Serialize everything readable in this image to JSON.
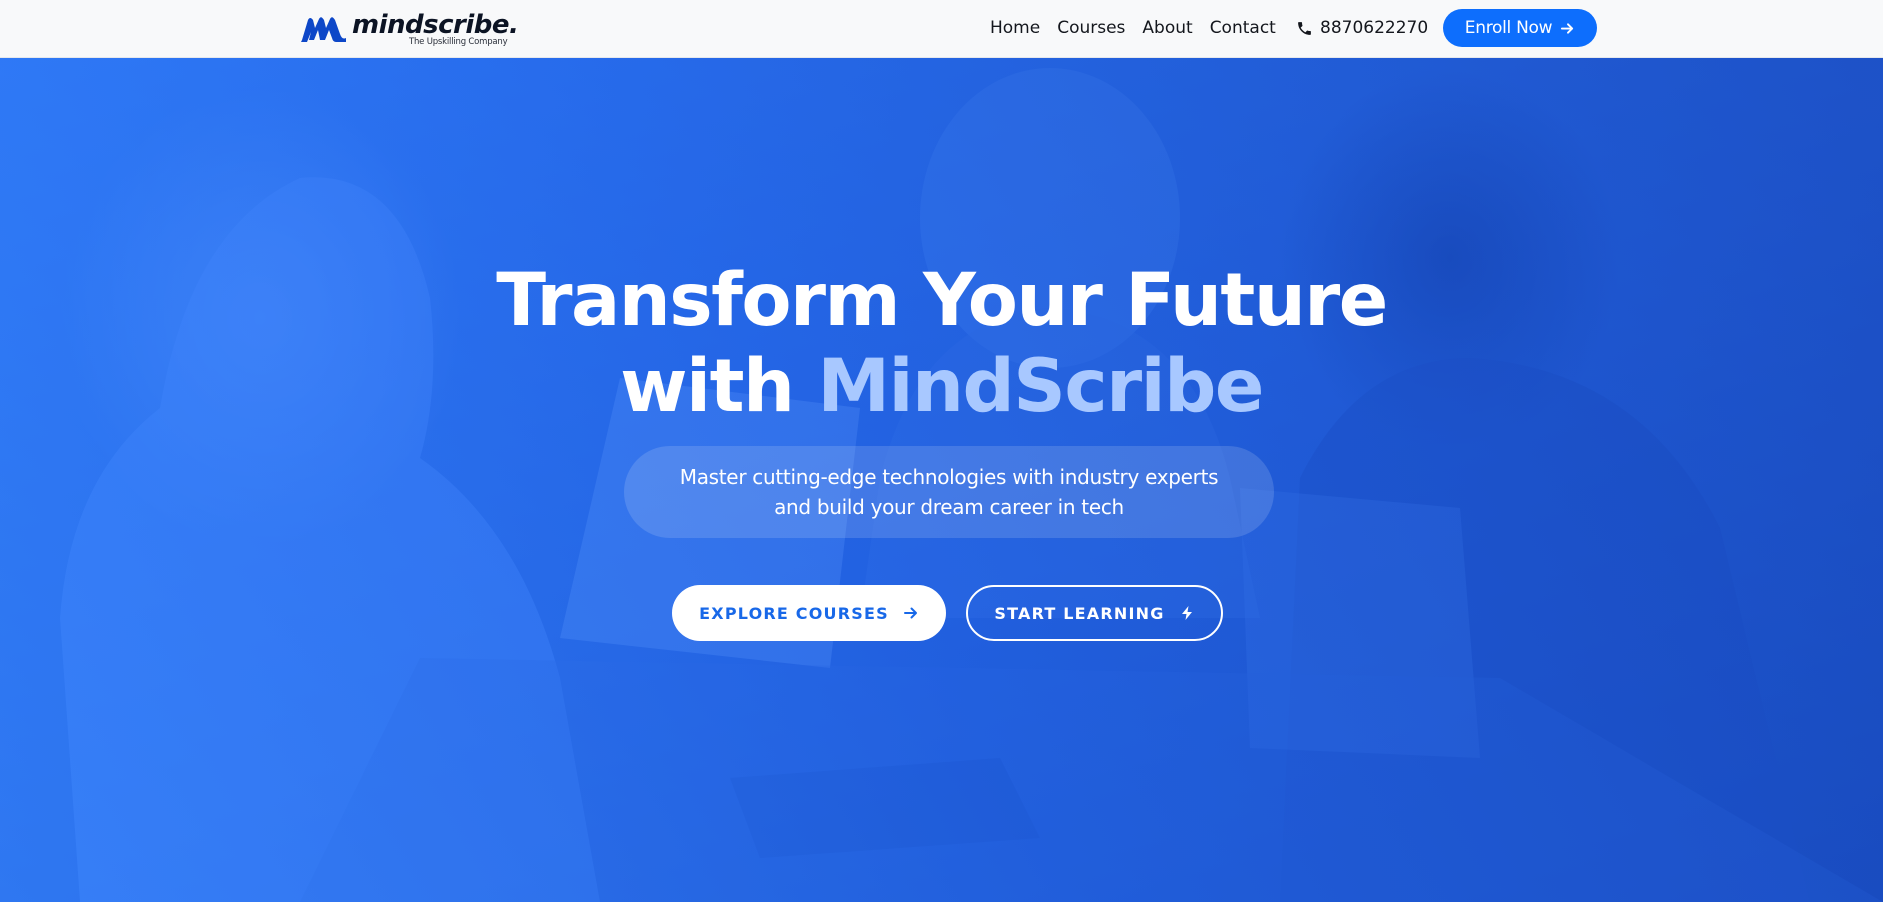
{
  "brand": {
    "name": "mindscribe.",
    "tagline": "The Upskilling Company",
    "mark_color": "#0d47c8"
  },
  "nav": {
    "links": [
      {
        "label": "Home"
      },
      {
        "label": "Courses"
      },
      {
        "label": "About"
      },
      {
        "label": "Contact"
      }
    ],
    "phone_icon": "phone-icon",
    "phone": "8870622270",
    "enroll_label": "Enroll Now",
    "enroll_icon": "arrow-right-icon"
  },
  "hero": {
    "title_line1": "Transform Your Future",
    "title_line2_prefix": "with ",
    "title_line2_accent": "MindScribe",
    "subtitle_line1": "Master cutting-edge technologies with industry experts",
    "subtitle_line2": "and build your dream career in tech",
    "primary_button": {
      "label": "EXPLORE COURSES",
      "icon": "arrow-right-icon"
    },
    "secondary_button": {
      "label": "START LEARNING",
      "icon": "lightning-bolt-icon"
    },
    "background": "photo of people smiling around laptops",
    "overlay_color": "#2a6ff0",
    "accent_color": "#a8c8ff"
  },
  "colors": {
    "primary": "#0d6efd",
    "navbar_bg": "#f8f9fa",
    "text_dark": "#14171d"
  }
}
